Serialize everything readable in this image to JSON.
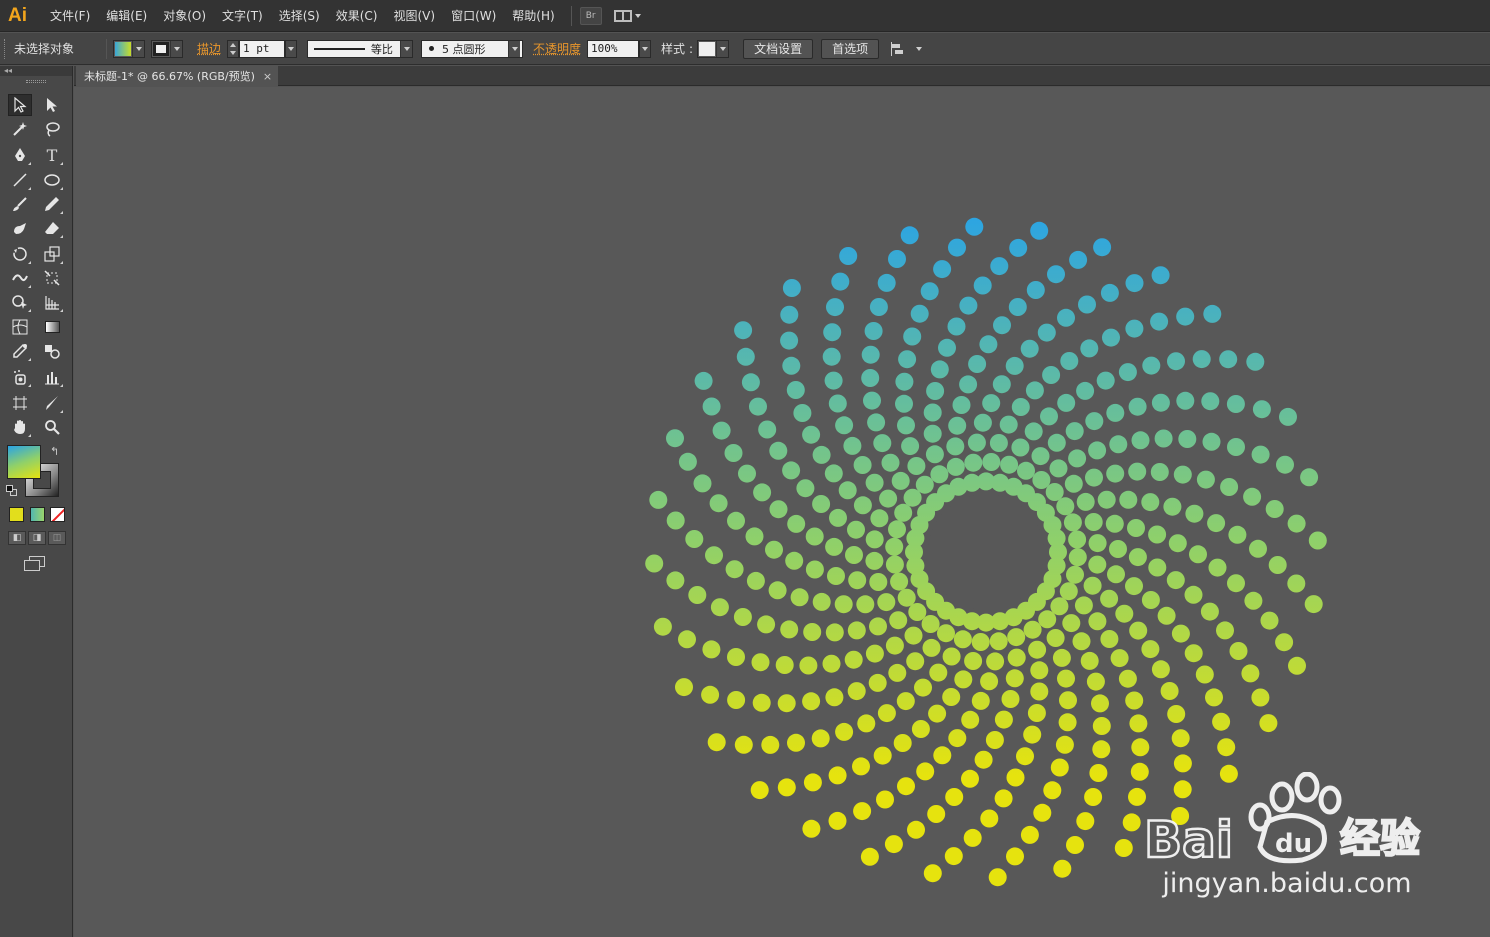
{
  "app": {
    "logo": "Ai"
  },
  "menu": {
    "items": [
      "文件(F)",
      "编辑(E)",
      "对象(O)",
      "文字(T)",
      "选择(S)",
      "效果(C)",
      "视图(V)",
      "窗口(W)",
      "帮助(H)"
    ],
    "bridge_label": "Br"
  },
  "control": {
    "selection_status": "未选择对象",
    "stroke_label": "描边",
    "stroke_weight": "1 pt",
    "stroke_profile": "等比",
    "brush": "5 点圆形",
    "opacity_label": "不透明度",
    "opacity_value": "100%",
    "style_label": "样式",
    "doc_setup_button": "文档设置",
    "preferences_button": "首选项"
  },
  "document": {
    "tab_title": "未标题-1* @ 66.67% (RGB/预览)",
    "tab_close": "×"
  },
  "colors": {
    "gradient_top": "#29a3e6",
    "gradient_mid": "#8fd06a",
    "gradient_bottom": "#e6e30e",
    "fill_swatch_1": "#e2de1c",
    "fill_swatch_2": "#53b7b0",
    "accent": "#f2a51c"
  },
  "toolbox": {
    "tools": [
      "selection-tool",
      "direct-selection-tool",
      "magic-wand-tool",
      "lasso-tool",
      "pen-tool",
      "type-tool",
      "line-segment-tool",
      "ellipse-tool",
      "paintbrush-tool",
      "pencil-tool",
      "blob-brush-tool",
      "eraser-tool",
      "rotate-tool",
      "scale-tool",
      "warp-tool",
      "free-transform-tool",
      "shape-builder-tool",
      "perspective-grid-tool",
      "mesh-tool",
      "gradient-tool",
      "eyedropper-tool",
      "blend-tool",
      "symbol-sprayer-tool",
      "column-graph-tool",
      "artboard-tool",
      "slice-tool",
      "hand-tool",
      "zoom-tool"
    ]
  },
  "watermark": {
    "brand": "Bai du 经验",
    "url": "jingyan.baidu.com"
  }
}
